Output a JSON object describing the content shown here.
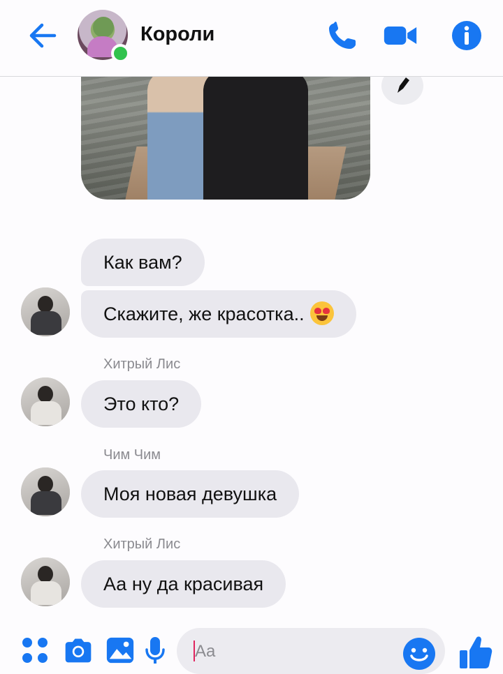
{
  "header": {
    "title": "Короли",
    "accent_color": "#1877f2",
    "online_color": "#31c24d"
  },
  "messages": [
    {
      "text": "Как вам?"
    },
    {
      "text": "Скажите, же красотка.."
    },
    {
      "sender": "Хитрый Лис",
      "text": "Это кто?"
    },
    {
      "sender": "Чим Чим",
      "text": "Моя новая девушка"
    },
    {
      "sender": "Хитрый Лис",
      "text": "Аа ну да красивая"
    }
  ],
  "composer": {
    "placeholder": "Aa"
  }
}
